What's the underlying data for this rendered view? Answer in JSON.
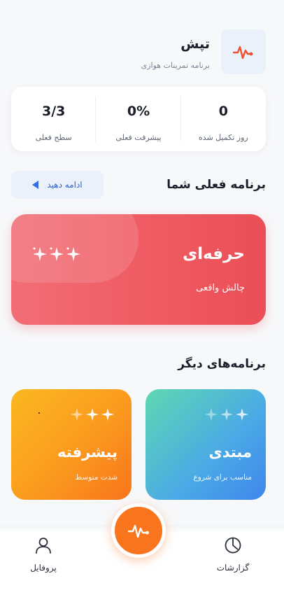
{
  "header": {
    "title": "تپش",
    "subtitle": "برنامه تمرینات هوازی",
    "logo_icon": "heartbeat-icon",
    "accent": "#f0502e"
  },
  "stats": [
    {
      "value": "0",
      "label": "روز تکمیل شده"
    },
    {
      "value": "0%",
      "label": "پیشرفت فعلی"
    },
    {
      "value": "3/3",
      "label": "سطح فعلی"
    }
  ],
  "current_section": {
    "title": "برنامه فعلی شما",
    "continue_label": "ادامه دهید"
  },
  "current_program": {
    "title": "حرفه‌ای",
    "subtitle": "چالش واقعی",
    "color": "#ef5b62"
  },
  "other_section": {
    "title": "برنامه‌های دیگر"
  },
  "other_programs": [
    {
      "title": "مبتدی",
      "subtitle": "مناسب برای شروع"
    },
    {
      "title": "پیشرفته",
      "subtitle": "شدت متوسط"
    }
  ],
  "nav": {
    "reports_label": "گزارشات",
    "profile_label": "پروفایل",
    "center_icon": "heartbeat-icon",
    "center_color": "#f8741d"
  }
}
